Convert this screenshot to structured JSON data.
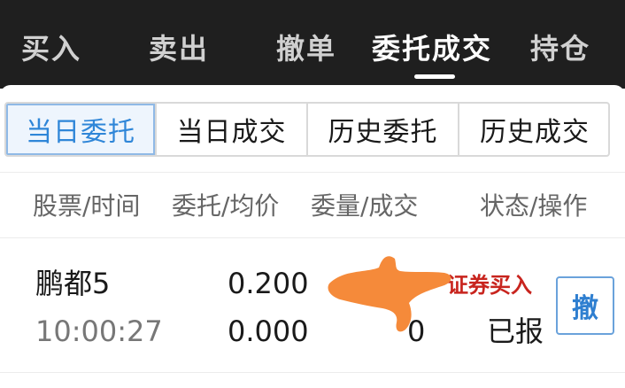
{
  "top_tabs": [
    {
      "label": "买入"
    },
    {
      "label": "卖出"
    },
    {
      "label": "撤单"
    },
    {
      "label": "委托成交",
      "active": true
    },
    {
      "label": "持仓"
    }
  ],
  "sub_tabs": [
    {
      "label": "当日委托",
      "active": true
    },
    {
      "label": "当日成交"
    },
    {
      "label": "历史委托"
    },
    {
      "label": "历史成交"
    }
  ],
  "table": {
    "headers": [
      "股票/时间",
      "委托/均价",
      "委量/成交",
      "状态/操作"
    ],
    "rows": [
      {
        "stock": "鹏都5",
        "time": "10:00:27",
        "order_price": "0.200",
        "avg_price": "0.000",
        "order_qty": "",
        "filled_qty": "0",
        "action_type": "证券买入",
        "status": "已报",
        "cancel_label": "撤"
      }
    ]
  },
  "colors": {
    "accent_blue": "#2f86d8",
    "action_red": "#c8241e",
    "topbar_bg": "#1f1f1f",
    "smear_orange": "#f58a3a"
  }
}
